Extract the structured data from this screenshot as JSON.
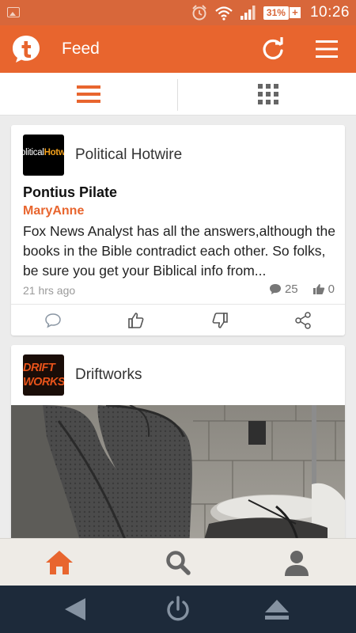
{
  "status_bar": {
    "battery": "31%",
    "battery_plus": "+",
    "time": "10:26"
  },
  "app_bar": {
    "title": "Feed",
    "icons": [
      "tapatalk-logo-icon",
      "refresh-icon",
      "menu-icon"
    ]
  },
  "view_toggle": {
    "options": [
      "list-view-icon",
      "grid-view-icon"
    ],
    "selected": "list"
  },
  "feed": {
    "posts": [
      {
        "source": "Political Hotwire",
        "logo_text_white": "olitical",
        "logo_text_orange": "Hotwi",
        "title": "Pontius Pilate",
        "author": "MaryAnne",
        "excerpt": "Fox News Analyst has all the answers,although the books in the Bible contradict each other. So folks, be sure you get your Biblical info from...",
        "time": "21 hrs ago",
        "comments": "25",
        "likes": "0"
      },
      {
        "source": "Driftworks",
        "logo_line1": "DRIFT",
        "logo_line2": "WORKS"
      }
    ]
  },
  "tab_bar": {
    "tabs": [
      "home-icon",
      "search-icon",
      "profile-icon"
    ],
    "active": "home"
  },
  "colors": {
    "accent": "#e8652e",
    "status_bar": "#d8673a",
    "nav_bar": "#1d2a3a",
    "tab_bar": "#eeebe6"
  }
}
